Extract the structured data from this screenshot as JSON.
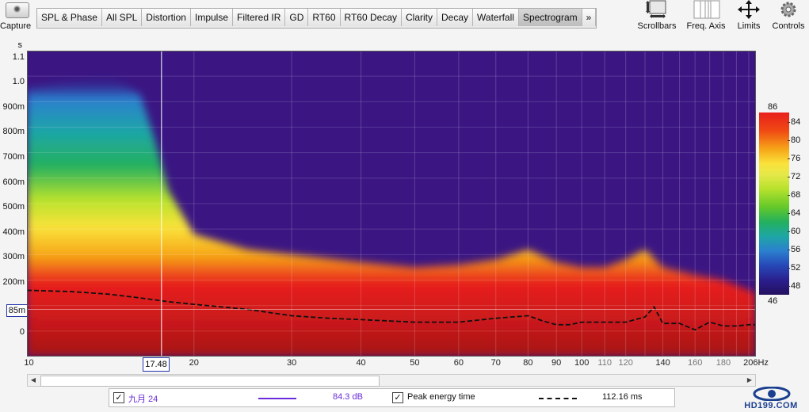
{
  "capture": {
    "label": "Capture"
  },
  "tabs": [
    {
      "label": "SPL & Phase"
    },
    {
      "label": "All SPL"
    },
    {
      "label": "Distortion"
    },
    {
      "label": "Impulse"
    },
    {
      "label": "Filtered IR"
    },
    {
      "label": "GD"
    },
    {
      "label": "RT60"
    },
    {
      "label": "RT60 Decay"
    },
    {
      "label": "Clarity"
    },
    {
      "label": "Decay"
    },
    {
      "label": "Waterfall"
    },
    {
      "label": "Spectrogram"
    },
    {
      "label": "»"
    }
  ],
  "active_tab": "Spectrogram",
  "tools": {
    "scrollbars": "Scrollbars",
    "freq_axis": "Freq. Axis",
    "limits": "Limits",
    "controls": "Controls"
  },
  "y_axis": {
    "unit": "s",
    "ticks": [
      "1.1",
      "1.0",
      "900m",
      "800m",
      "700m",
      "600m",
      "500m",
      "400m",
      "300m",
      "200m",
      "0"
    ],
    "cursor": "85m"
  },
  "x_axis": {
    "unit": "Hz",
    "major": [
      "10",
      "20",
      "30",
      "40",
      "50",
      "60",
      "70",
      "80",
      "90",
      "100",
      "140",
      "206"
    ],
    "minor": [
      "110",
      "120",
      "160",
      "180"
    ],
    "cursor": "17.48"
  },
  "color_scale": {
    "top": "86",
    "bottom": "46",
    "ticks": [
      "84",
      "80",
      "76",
      "72",
      "68",
      "64",
      "60",
      "56",
      "52",
      "48"
    ]
  },
  "legend": {
    "series1_name": "九月 24",
    "series1_value": "84.3 dB",
    "series1_color": "#6a2bd8",
    "series2_name": "Peak energy time",
    "series2_value": "112.16 ms",
    "series1_checked": "✓",
    "series2_checked": "✓"
  },
  "chart_data": {
    "type": "heatmap",
    "xlabel": "Hz",
    "ylabel": "s",
    "x_scale": "log",
    "xlim": [
      10,
      206
    ],
    "ylim": [
      -0.1,
      1.1
    ],
    "color_range_db": [
      46,
      86
    ],
    "cursor": {
      "x": 17.48,
      "y": 0.085
    },
    "series": [
      {
        "name": "Peak energy time",
        "x": [
          10,
          12,
          14,
          16,
          18,
          20,
          25,
          30,
          35,
          40,
          50,
          60,
          70,
          80,
          85,
          90,
          95,
          100,
          110,
          120,
          130,
          135,
          140,
          150,
          160,
          170,
          180,
          190,
          200,
          206
        ],
        "y": [
          0.16,
          0.155,
          0.145,
          0.13,
          0.115,
          0.105,
          0.085,
          0.06,
          0.05,
          0.045,
          0.035,
          0.035,
          0.05,
          0.06,
          0.04,
          0.025,
          0.025,
          0.035,
          0.035,
          0.035,
          0.055,
          0.095,
          0.03,
          0.03,
          0.005,
          0.035,
          0.02,
          0.02,
          0.025,
          0.025
        ]
      }
    ],
    "energy_top_s": {
      "x": [
        10,
        12,
        14,
        16,
        17,
        18,
        20,
        25,
        30,
        40,
        50,
        60,
        70,
        80,
        90,
        100,
        110,
        120,
        130,
        140,
        160,
        180,
        206
      ],
      "y": [
        0.95,
        0.98,
        1.0,
        0.93,
        0.75,
        0.55,
        0.38,
        0.32,
        0.3,
        0.27,
        0.25,
        0.26,
        0.28,
        0.32,
        0.27,
        0.25,
        0.25,
        0.28,
        0.32,
        0.25,
        0.22,
        0.2,
        0.15
      ]
    }
  }
}
